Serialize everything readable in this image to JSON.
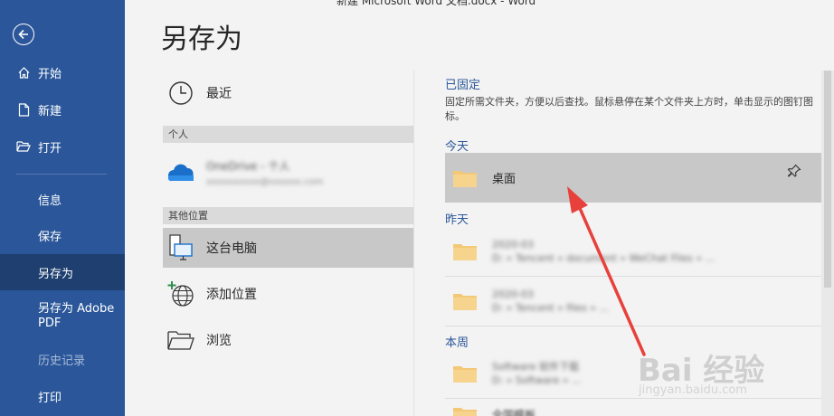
{
  "colors": {
    "brand": "#2b579a",
    "active": "#1e3f6f",
    "accent": "#2b579a",
    "arrow": "#e8413c",
    "folder": "#f3c877"
  },
  "window": {
    "title": "新建 Microsoft Word 文档.docx - Word"
  },
  "sidebar": {
    "back_icon": "back-arrow-icon",
    "items": [
      {
        "label": "开始",
        "icon": "home-icon"
      },
      {
        "label": "新建",
        "icon": "new-document-icon"
      },
      {
        "label": "打开",
        "icon": "open-folder-icon"
      },
      {
        "label": "信息"
      },
      {
        "label": "保存"
      },
      {
        "label": "另存为",
        "active": true
      },
      {
        "label": "另存为 Adobe PDF"
      },
      {
        "label": "历史记录",
        "disabled": true
      },
      {
        "label": "打印"
      }
    ]
  },
  "page": {
    "title": "另存为"
  },
  "locations": {
    "recent": {
      "label": "最近",
      "icon": "clock-icon"
    },
    "personal_header": "个人",
    "onedrive": {
      "icon": "onedrive-icon",
      "name": "OneDrive - 个人",
      "email": "xxxxxxxxxx@xxxxxx.com"
    },
    "other_header": "其他位置",
    "this_pc": {
      "label": "这台电脑",
      "icon": "computer-icon",
      "selected": true
    },
    "add_place": {
      "label": "添加位置",
      "icon": "add-globe-icon"
    },
    "browse": {
      "label": "浏览",
      "icon": "browse-folder-icon"
    }
  },
  "folders": {
    "pinned_header": "已固定",
    "pinned_desc": "固定所需文件夹，方便以后查找。鼠标悬停在某个文件夹上方时，单击显示的图钉图标。",
    "today_header": "今天",
    "today_items": [
      {
        "name": "桌面"
      }
    ],
    "yesterday_header": "昨天",
    "yesterday_items": [
      {
        "name": "2020-03",
        "path": "D: » Tencent » document » WeChat Files » ..."
      },
      {
        "name": "2020-03",
        "path": "D: » Tencent » files » ..."
      }
    ],
    "week_header": "本周",
    "week_items": [
      {
        "name": "Software 软件下载",
        "path": "D: » Software » ..."
      },
      {
        "name": "全国模板"
      }
    ]
  },
  "watermark": {
    "main": "Bai 经验",
    "sub": "jingyan.baidu.com"
  }
}
